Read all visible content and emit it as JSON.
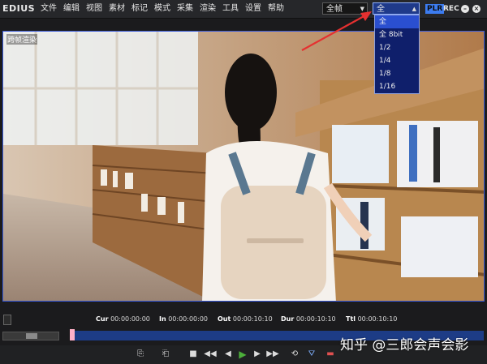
{
  "app": {
    "logo": "EDIUS"
  },
  "menu": [
    "文件",
    "编辑",
    "视图",
    "素材",
    "标记",
    "模式",
    "采集",
    "渲染",
    "工具",
    "设置",
    "帮助"
  ],
  "toolbar": {
    "frame_mode": "全帧",
    "resolution": "全",
    "plr": "PLR",
    "rec": "REC",
    "minimize": "–",
    "close": "×"
  },
  "dropdown": {
    "options": [
      "全",
      "全 8bit",
      "1/2",
      "1/4",
      "1/8",
      "1/16"
    ],
    "selected": 0
  },
  "preview": {
    "clip_name": "跨帧渲染"
  },
  "timecodes": {
    "cur_label": "Cur",
    "cur": "00:00:00:00",
    "in_label": "In",
    "in": "00:00:00:00",
    "out_label": "Out",
    "out": "00:00:10:10",
    "dur_label": "Dur",
    "dur": "00:00:10:10",
    "ttl_label": "Ttl",
    "ttl": "00:00:10:10"
  },
  "watermark": "知乎 @三郎会声会影",
  "colors": {
    "accent": "#3a5ad8",
    "dropdown_bg": "#0f1f6b",
    "play": "#4caf3a",
    "annotation": "#e53030"
  }
}
